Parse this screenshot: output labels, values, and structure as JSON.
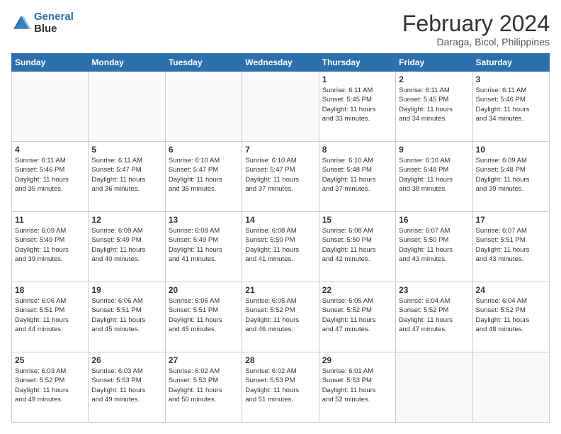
{
  "logo": {
    "general": "General",
    "blue": "Blue"
  },
  "title": "February 2024",
  "subtitle": "Daraga, Bicol, Philippines",
  "days": [
    "Sunday",
    "Monday",
    "Tuesday",
    "Wednesday",
    "Thursday",
    "Friday",
    "Saturday"
  ],
  "weeks": [
    [
      {
        "day": "",
        "info": ""
      },
      {
        "day": "",
        "info": ""
      },
      {
        "day": "",
        "info": ""
      },
      {
        "day": "",
        "info": ""
      },
      {
        "day": "1",
        "info": "Sunrise: 6:11 AM\nSunset: 5:45 PM\nDaylight: 11 hours\nand 33 minutes."
      },
      {
        "day": "2",
        "info": "Sunrise: 6:11 AM\nSunset: 5:45 PM\nDaylight: 11 hours\nand 34 minutes."
      },
      {
        "day": "3",
        "info": "Sunrise: 6:11 AM\nSunset: 5:46 PM\nDaylight: 11 hours\nand 34 minutes."
      }
    ],
    [
      {
        "day": "4",
        "info": "Sunrise: 6:11 AM\nSunset: 5:46 PM\nDaylight: 11 hours\nand 35 minutes."
      },
      {
        "day": "5",
        "info": "Sunrise: 6:11 AM\nSunset: 5:47 PM\nDaylight: 11 hours\nand 36 minutes."
      },
      {
        "day": "6",
        "info": "Sunrise: 6:10 AM\nSunset: 5:47 PM\nDaylight: 11 hours\nand 36 minutes."
      },
      {
        "day": "7",
        "info": "Sunrise: 6:10 AM\nSunset: 5:47 PM\nDaylight: 11 hours\nand 37 minutes."
      },
      {
        "day": "8",
        "info": "Sunrise: 6:10 AM\nSunset: 5:48 PM\nDaylight: 11 hours\nand 37 minutes."
      },
      {
        "day": "9",
        "info": "Sunrise: 6:10 AM\nSunset: 5:48 PM\nDaylight: 11 hours\nand 38 minutes."
      },
      {
        "day": "10",
        "info": "Sunrise: 6:09 AM\nSunset: 5:48 PM\nDaylight: 11 hours\nand 39 minutes."
      }
    ],
    [
      {
        "day": "11",
        "info": "Sunrise: 6:09 AM\nSunset: 5:49 PM\nDaylight: 11 hours\nand 39 minutes."
      },
      {
        "day": "12",
        "info": "Sunrise: 6:09 AM\nSunset: 5:49 PM\nDaylight: 11 hours\nand 40 minutes."
      },
      {
        "day": "13",
        "info": "Sunrise: 6:08 AM\nSunset: 5:49 PM\nDaylight: 11 hours\nand 41 minutes."
      },
      {
        "day": "14",
        "info": "Sunrise: 6:08 AM\nSunset: 5:50 PM\nDaylight: 11 hours\nand 41 minutes."
      },
      {
        "day": "15",
        "info": "Sunrise: 6:08 AM\nSunset: 5:50 PM\nDaylight: 11 hours\nand 42 minutes."
      },
      {
        "day": "16",
        "info": "Sunrise: 6:07 AM\nSunset: 5:50 PM\nDaylight: 11 hours\nand 43 minutes."
      },
      {
        "day": "17",
        "info": "Sunrise: 6:07 AM\nSunset: 5:51 PM\nDaylight: 11 hours\nand 43 minutes."
      }
    ],
    [
      {
        "day": "18",
        "info": "Sunrise: 6:06 AM\nSunset: 5:51 PM\nDaylight: 11 hours\nand 44 minutes."
      },
      {
        "day": "19",
        "info": "Sunrise: 6:06 AM\nSunset: 5:51 PM\nDaylight: 11 hours\nand 45 minutes."
      },
      {
        "day": "20",
        "info": "Sunrise: 6:06 AM\nSunset: 5:51 PM\nDaylight: 11 hours\nand 45 minutes."
      },
      {
        "day": "21",
        "info": "Sunrise: 6:05 AM\nSunset: 5:52 PM\nDaylight: 11 hours\nand 46 minutes."
      },
      {
        "day": "22",
        "info": "Sunrise: 6:05 AM\nSunset: 5:52 PM\nDaylight: 11 hours\nand 47 minutes."
      },
      {
        "day": "23",
        "info": "Sunrise: 6:04 AM\nSunset: 5:52 PM\nDaylight: 11 hours\nand 47 minutes."
      },
      {
        "day": "24",
        "info": "Sunrise: 6:04 AM\nSunset: 5:52 PM\nDaylight: 11 hours\nand 48 minutes."
      }
    ],
    [
      {
        "day": "25",
        "info": "Sunrise: 6:03 AM\nSunset: 5:52 PM\nDaylight: 11 hours\nand 49 minutes."
      },
      {
        "day": "26",
        "info": "Sunrise: 6:03 AM\nSunset: 5:53 PM\nDaylight: 11 hours\nand 49 minutes."
      },
      {
        "day": "27",
        "info": "Sunrise: 6:02 AM\nSunset: 5:53 PM\nDaylight: 11 hours\nand 50 minutes."
      },
      {
        "day": "28",
        "info": "Sunrise: 6:02 AM\nSunset: 5:53 PM\nDaylight: 11 hours\nand 51 minutes."
      },
      {
        "day": "29",
        "info": "Sunrise: 6:01 AM\nSunset: 5:53 PM\nDaylight: 11 hours\nand 52 minutes."
      },
      {
        "day": "",
        "info": ""
      },
      {
        "day": "",
        "info": ""
      }
    ]
  ]
}
